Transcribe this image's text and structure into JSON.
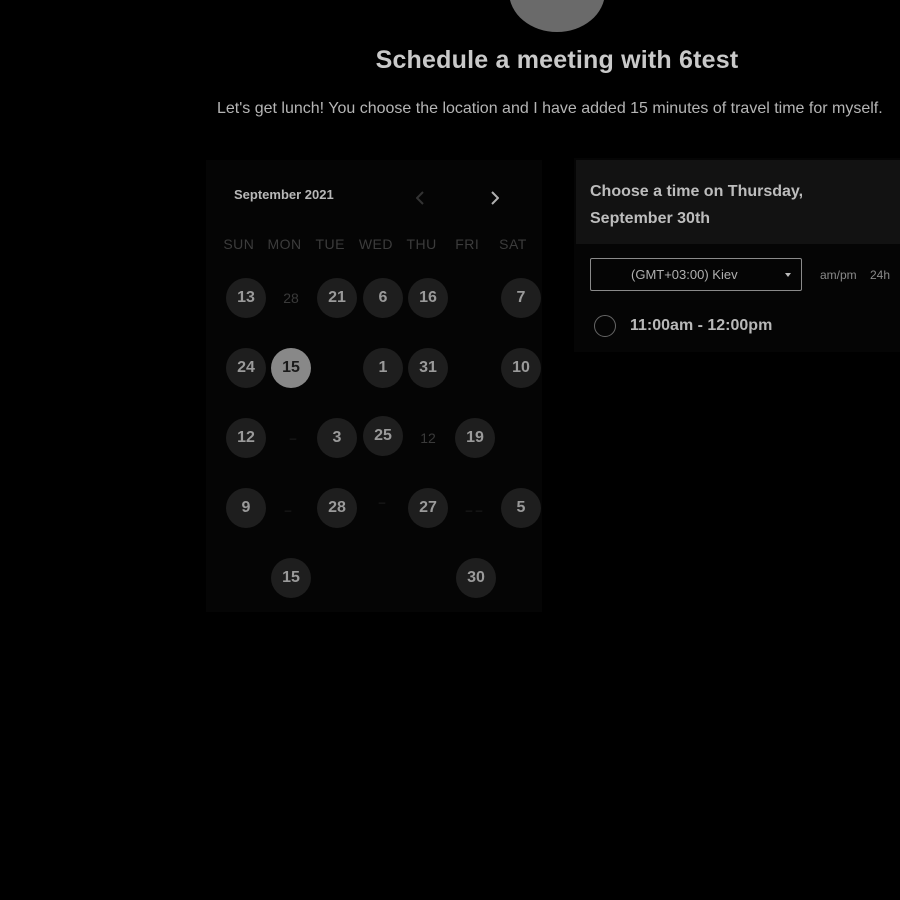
{
  "header": {
    "title": "Schedule a meeting with 6test",
    "description": "Let's get lunch! You choose the location and I have added 15 minutes of travel time for myself."
  },
  "calendar": {
    "month_label": "September 2021",
    "prev_icon": "chevron-left-icon",
    "next_icon": "chevron-right-icon",
    "weekdays": [
      "SUN",
      "MON",
      "TUE",
      "WED",
      "THU",
      "FRI",
      "SAT"
    ],
    "rows": [
      [
        "13",
        "28",
        "21",
        "6",
        "16",
        "",
        "7"
      ],
      [
        "24",
        "15",
        "",
        "1",
        "31",
        "",
        "10"
      ],
      [
        "12",
        "–",
        "3",
        "25",
        "12",
        "19",
        ""
      ],
      [
        "9",
        "–",
        "28",
        "–",
        "27",
        "– –",
        "5"
      ],
      [
        "",
        "15",
        "",
        "",
        "",
        "30",
        ""
      ]
    ],
    "selected_day": "15"
  },
  "time_panel": {
    "heading": "Choose a time on Thursday, September 30th",
    "timezone": "(GMT+03:00) Kiev",
    "format_ampm": "am/pm",
    "format_24": "24h",
    "slots": [
      "11:00am - 12:00pm"
    ]
  },
  "colors": {
    "background": "#000000",
    "available_day": "#1e1e1e",
    "selected_day": "#888888"
  }
}
